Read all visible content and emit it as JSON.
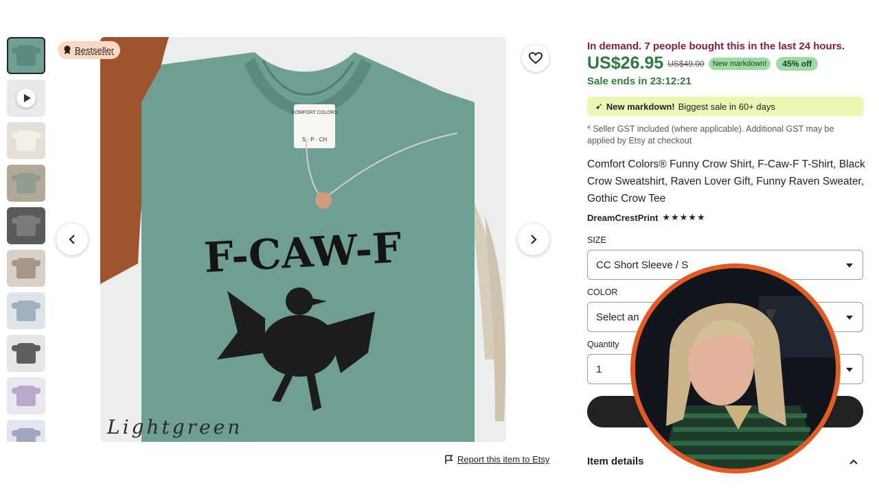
{
  "gallery": {
    "bestseller_label": "Bestseller",
    "thumbnail_colors": [
      "#6f9f94",
      "#e9e9ec",
      "#e5e0d6",
      "#8f9c8e",
      "#7a7a7a",
      "#a79688",
      "#9fb0c0",
      "#5f5f5f",
      "#ece6f0",
      "#e3e6ee"
    ],
    "photo_text": {
      "label_brand": "COMFORT COLORS",
      "label_sizes": "S · P · CH",
      "print_text": "F-CAW-F",
      "caption": "Lightgreen"
    },
    "report_label": "Report this item to Etsy"
  },
  "listing": {
    "demand_text": "In demand. 7 people bought this in the last 24 hours.",
    "price": "US$26.95",
    "old_price": "US$49.00",
    "new_markdown_badge": "New markdown!",
    "discount_badge": "45% off",
    "sale_ends": "Sale ends in 23:12:21",
    "markdown_banner_bold": "New markdown!",
    "markdown_banner_rest": "Biggest sale in 60+ days",
    "gst_note": "* Seller GST included (where applicable). Additional GST may be applied by Etsy at checkout",
    "title": "Comfort Colors® Funny Crow Shirt, F-Caw-F T-Shirt, Black Crow Sweatshirt, Raven Lover Gift, Funny Raven Sweater, Gothic Crow Tee",
    "shop_name": "DreamCrestPrint",
    "stars": "★★★★★",
    "size_label": "SIZE",
    "size_value": "CC Short Sleeve / S",
    "color_label": "COLOR",
    "color_value": "Select an",
    "quantity_label": "Quantity",
    "quantity_value": "1",
    "item_details_label": "Item details"
  },
  "colors": {
    "demand": "#8d1b3d",
    "price_green": "#2f7a3e",
    "shirt": "#6f9f94",
    "hat": "#a0532f",
    "webcam_ring": "#e25a24"
  }
}
